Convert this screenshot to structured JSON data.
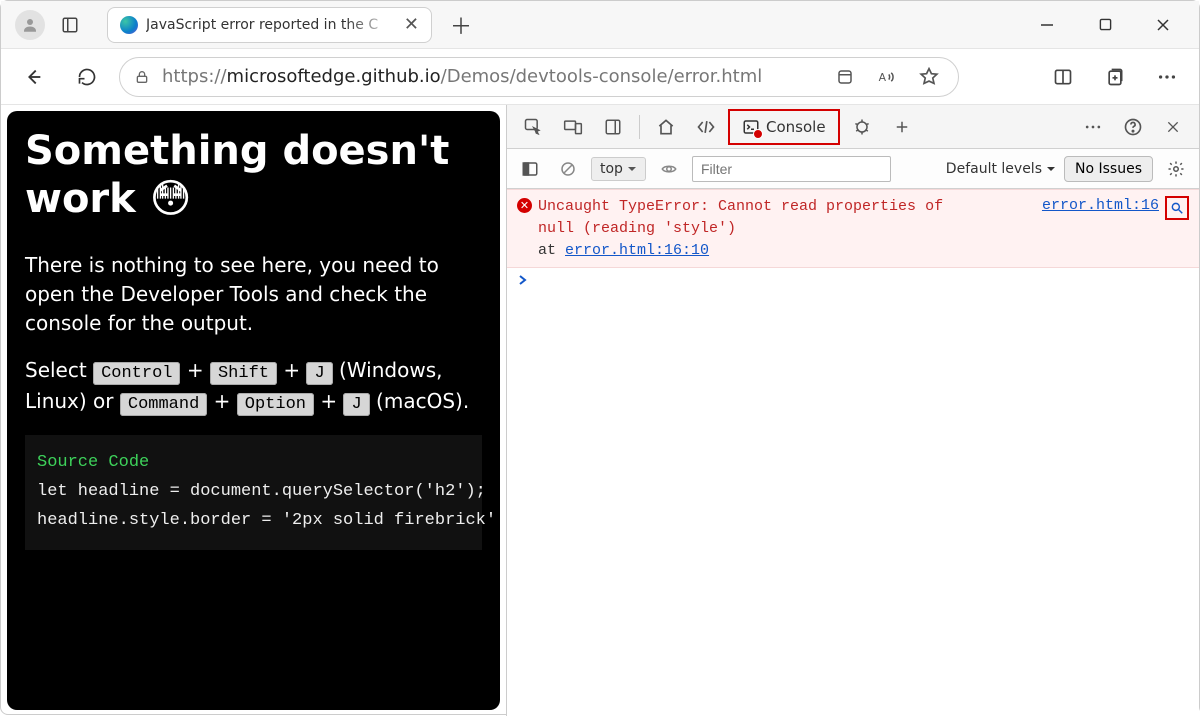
{
  "browser": {
    "tab_title": "JavaScript error reported in the C",
    "url_prefix": "https://",
    "url_host": "microsoftedge.github.io",
    "url_path": "/Demos/devtools-console/error.html"
  },
  "page": {
    "heading": "Something doesn't work ",
    "emoji": "😳",
    "para1": "There is nothing to see here, you need to open the Developer Tools and check the console for the output.",
    "select_word": "Select ",
    "kbd": {
      "ctrl": "Control",
      "shift": "Shift",
      "j": "J",
      "cmd": "Command",
      "opt": "Option"
    },
    "plus": " + ",
    "win_suffix": " (Windows, Linux) or ",
    "mac_suffix": " (macOS).",
    "code_title": "Source Code",
    "code_line1": "let headline = document.querySelector('h2');",
    "code_line2": "headline.style.border = '2px solid firebrick'"
  },
  "devtools": {
    "console_tab": "Console",
    "context": "top",
    "filter_placeholder": "Filter",
    "levels": "Default levels",
    "issues": "No Issues",
    "error": {
      "msg_l1": "Uncaught TypeError: Cannot read properties of",
      "msg_l2": "null (reading 'style')",
      "stack_prefix": "    at ",
      "stack_link": "error.html:16:10",
      "source_link": "error.html:16"
    },
    "prompt": "›"
  }
}
